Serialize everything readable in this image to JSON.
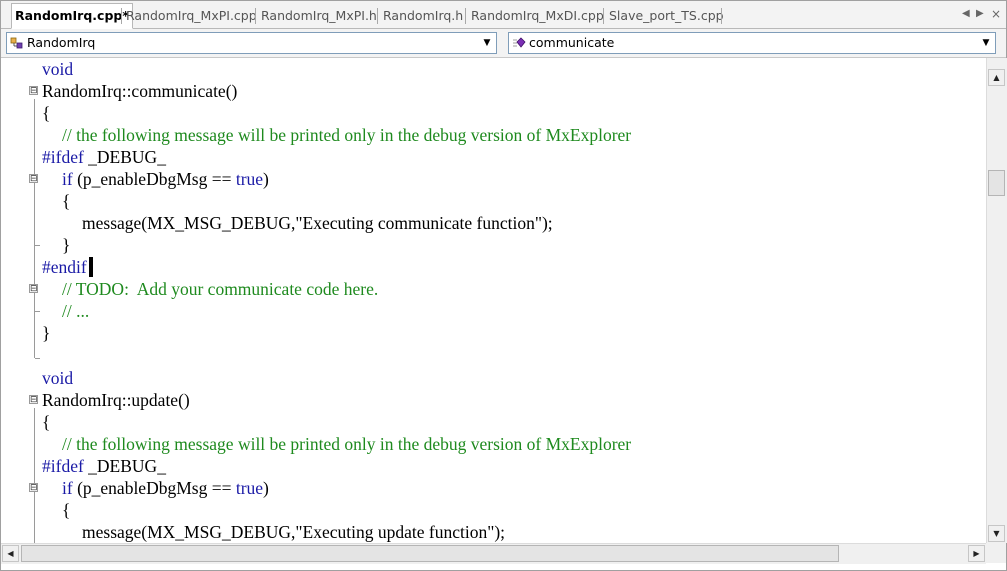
{
  "tabs": [
    {
      "label": "RandomIrq.cpp*",
      "active": true
    },
    {
      "label": "RandomIrq_MxPI.cpp",
      "active": false
    },
    {
      "label": "RandomIrq_MxPI.h",
      "active": false
    },
    {
      "label": "RandomIrq.h",
      "active": false
    },
    {
      "label": "RandomIrq_MxDI.cpp",
      "active": false
    },
    {
      "label": "Slave_port_TS.cpp",
      "active": false
    }
  ],
  "tab_nav": {
    "prev_icon": "triangle-left-icon",
    "next_icon": "triangle-right-icon",
    "close_icon": "close-icon"
  },
  "navbar": {
    "class_combo": {
      "value": "RandomIrq",
      "icon": "class-icon"
    },
    "member_combo": {
      "value": "communicate",
      "icon": "method-icon"
    }
  },
  "colors": {
    "keyword": "#1a1aa6",
    "comment": "#1e8a1e",
    "text": "#000000"
  },
  "code": {
    "l1": "void",
    "l2": "RandomIrq::communicate()",
    "l3": "{",
    "l4": "// the following message will be printed only in the debug version of MxExplorer",
    "l5a": "#ifdef",
    "l5b": " _DEBUG_",
    "l6a": "if",
    "l6b": " (p_enableDbgMsg == ",
    "l6c": "true",
    "l6d": ")",
    "l7": "{",
    "l8": "message(MX_MSG_DEBUG,\"Executing communicate function\");",
    "l9": "}",
    "l10": "#endif",
    "l11": "// TODO:  Add your communicate code here.",
    "l12": "// ...",
    "l13": "}",
    "l15": "void",
    "l16": "RandomIrq::update()",
    "l17": "{",
    "l18": "// the following message will be printed only in the debug version of MxExplorer",
    "l19a": "#ifdef",
    "l19b": " _DEBUG_",
    "l20a": "if",
    "l20b": " (p_enableDbgMsg == ",
    "l20c": "true",
    "l20d": ")",
    "l21": "{",
    "l22": "message(MX_MSG_DEBUG,\"Executing update function\");"
  },
  "fold_glyph": "⊟"
}
